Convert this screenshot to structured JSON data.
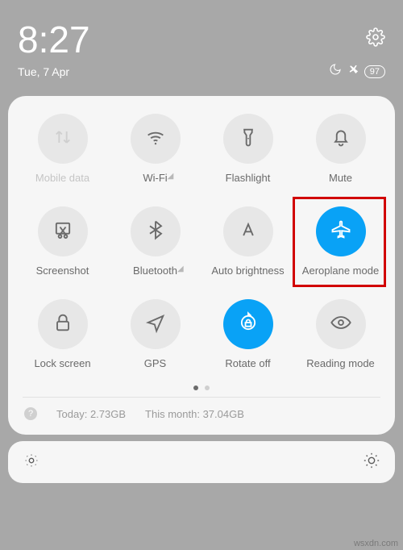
{
  "status": {
    "time": "8:27",
    "date": "Tue, 7 Apr",
    "battery": "97"
  },
  "tiles": [
    {
      "label": "Mobile data"
    },
    {
      "label": "Wi-Fi"
    },
    {
      "label": "Flashlight"
    },
    {
      "label": "Mute"
    },
    {
      "label": "Screenshot"
    },
    {
      "label": "Bluetooth"
    },
    {
      "label": "Auto brightness"
    },
    {
      "label": "Aeroplane mode"
    },
    {
      "label": "Lock screen"
    },
    {
      "label": "GPS"
    },
    {
      "label": "Rotate off"
    },
    {
      "label": "Reading mode"
    }
  ],
  "usage": {
    "today_label": "Today:",
    "today_value": "2.73GB",
    "month_label": "This month:",
    "month_value": "37.04GB"
  },
  "watermark": "wsxdn.com"
}
